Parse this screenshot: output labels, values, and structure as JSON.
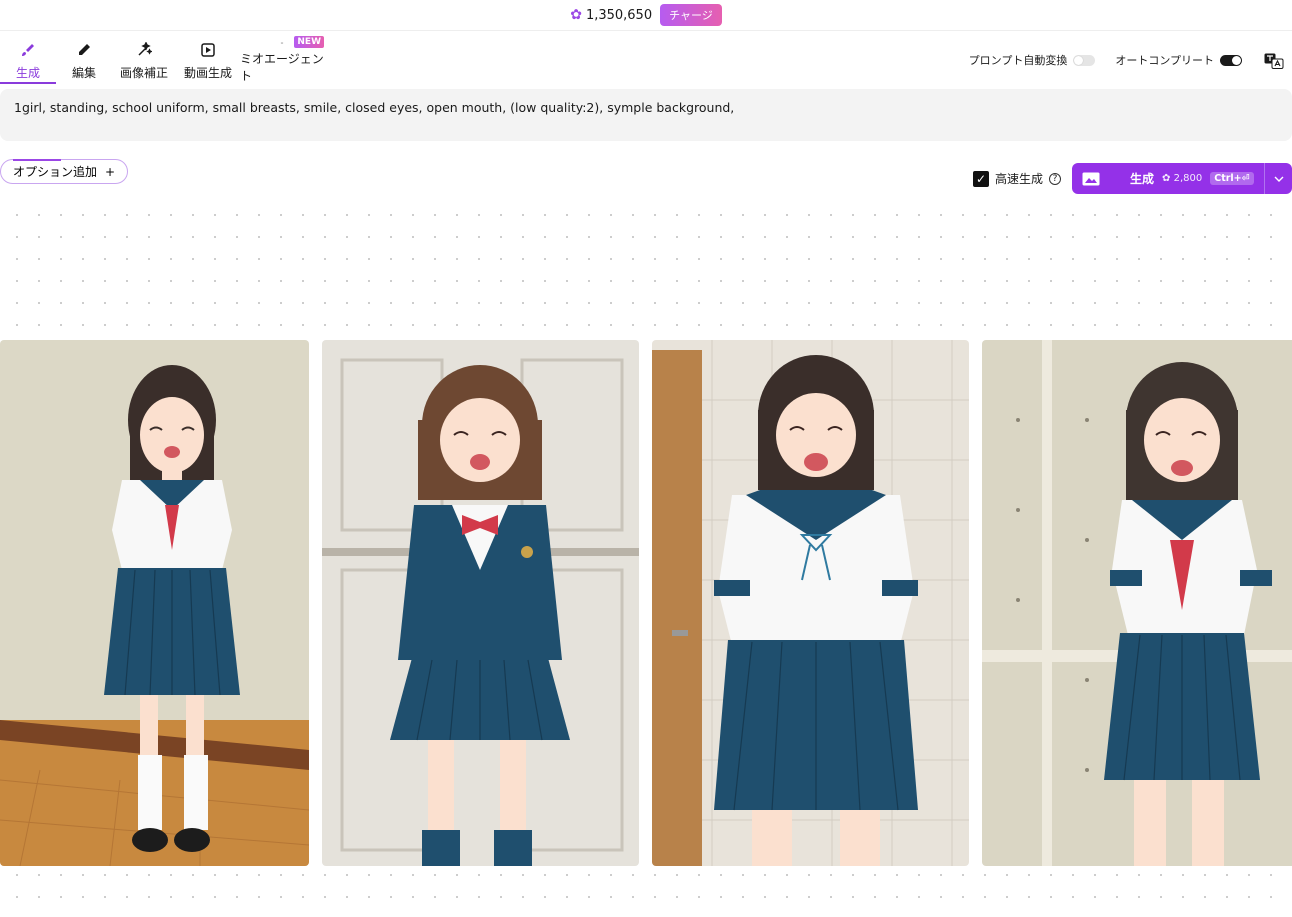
{
  "header": {
    "credits": "1,350,650",
    "charge_label": "チャージ"
  },
  "tabs": [
    {
      "label": "生成",
      "icon": "brush-icon",
      "active": true
    },
    {
      "label": "編集",
      "icon": "pencil-icon"
    },
    {
      "label": "画像補正",
      "icon": "sparkle-wand-icon"
    },
    {
      "label": "動画生成",
      "icon": "video-icon"
    },
    {
      "label": "ミオエージェント",
      "icon": "cat-icon",
      "badge": "NEW"
    }
  ],
  "toggles": {
    "auto_translate_label": "プロンプト自動変換",
    "auto_translate_on": false,
    "autocomplete_label": "オートコンプリート",
    "autocomplete_on": true
  },
  "prompt": {
    "text": "1girl, standing, school uniform, small breasts, smile, closed eyes, open mouth, (low quality:2), symple background,"
  },
  "options": {
    "add_label": "オプション追加"
  },
  "fast_gen": {
    "label": "高速生成",
    "checked": true
  },
  "generate": {
    "label": "生成",
    "cost": "2,800",
    "shortcut": "Ctrl+⏎"
  },
  "images": [
    {
      "alt": "girl in sailor uniform standing on wooden floor"
    },
    {
      "alt": "girl in navy blazer with red bow in front of doors"
    },
    {
      "alt": "girl in sailor uniform with blue ribbon by door"
    },
    {
      "alt": "girl in sailor uniform with red scarf by wall"
    }
  ],
  "colors": {
    "accent": "#9431e8",
    "navy": "#1f4f6e",
    "red": "#d23a4a"
  }
}
